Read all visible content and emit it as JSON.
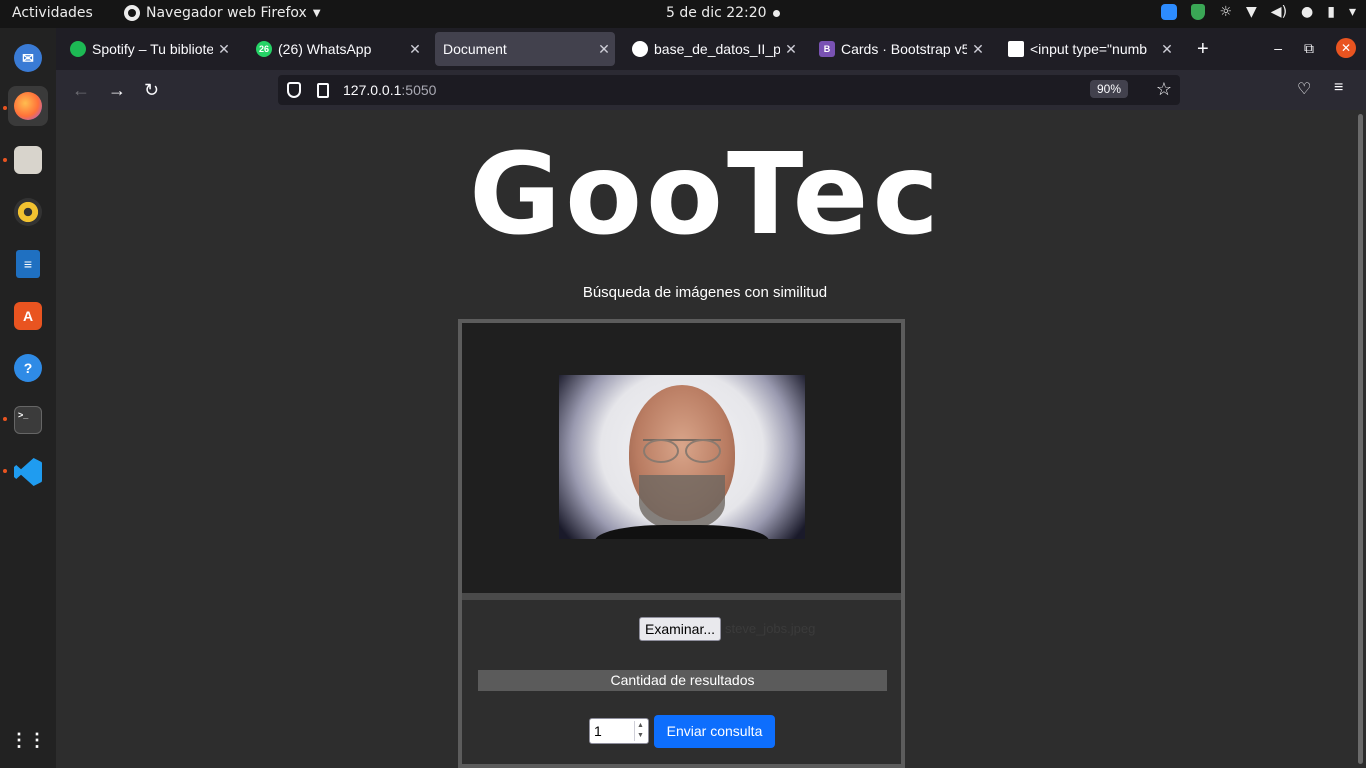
{
  "topbar": {
    "activities": "Actividades",
    "app_menu": "Navegador web Firefox",
    "clock": "5 de dic  22:20"
  },
  "dock": {
    "items": [
      "thunderbird-icon",
      "firefox-icon",
      "files-icon",
      "rhythmbox-icon",
      "libreoffice-writer-icon",
      "software-center-icon",
      "help-icon",
      "terminal-icon",
      "vscode-icon",
      "app-grid-icon"
    ]
  },
  "browser": {
    "tabs": [
      {
        "title": "Spotify – Tu bibliote",
        "favicon_color": "#1db954",
        "favicon": "spotify-icon"
      },
      {
        "title": "(26) WhatsApp",
        "favicon_color": "#25d366",
        "favicon": "whatsapp-icon",
        "badge": "26"
      },
      {
        "title": "Document",
        "favicon": "none",
        "active": true
      },
      {
        "title": "base_de_datos_II_p",
        "favicon_color": "#ffffff",
        "favicon": "github-icon"
      },
      {
        "title": "Cards · Bootstrap v5",
        "favicon_color": "#7952b3",
        "favicon": "bootstrap-icon",
        "favicon_letter": "B"
      },
      {
        "title": "<input type=\"numb",
        "favicon_color": "#ffffff",
        "favicon": "mdn-icon"
      }
    ],
    "url_host": "127.0.0.1",
    "url_port": ":5050",
    "zoom": "90%"
  },
  "page": {
    "logo": "GooTec",
    "subtitle": "Búsqueda de imágenes con similitud",
    "browse_button": "Examinar...",
    "file_name": "steve_jobs.jpeg",
    "results_label": "Cantidad de resultados",
    "quantity_value": "1",
    "submit_button": "Enviar consulta"
  },
  "colors": {
    "accent_blue": "#0d6efd",
    "page_bg": "#2d2d2d",
    "ubuntu_orange": "#e95420"
  }
}
